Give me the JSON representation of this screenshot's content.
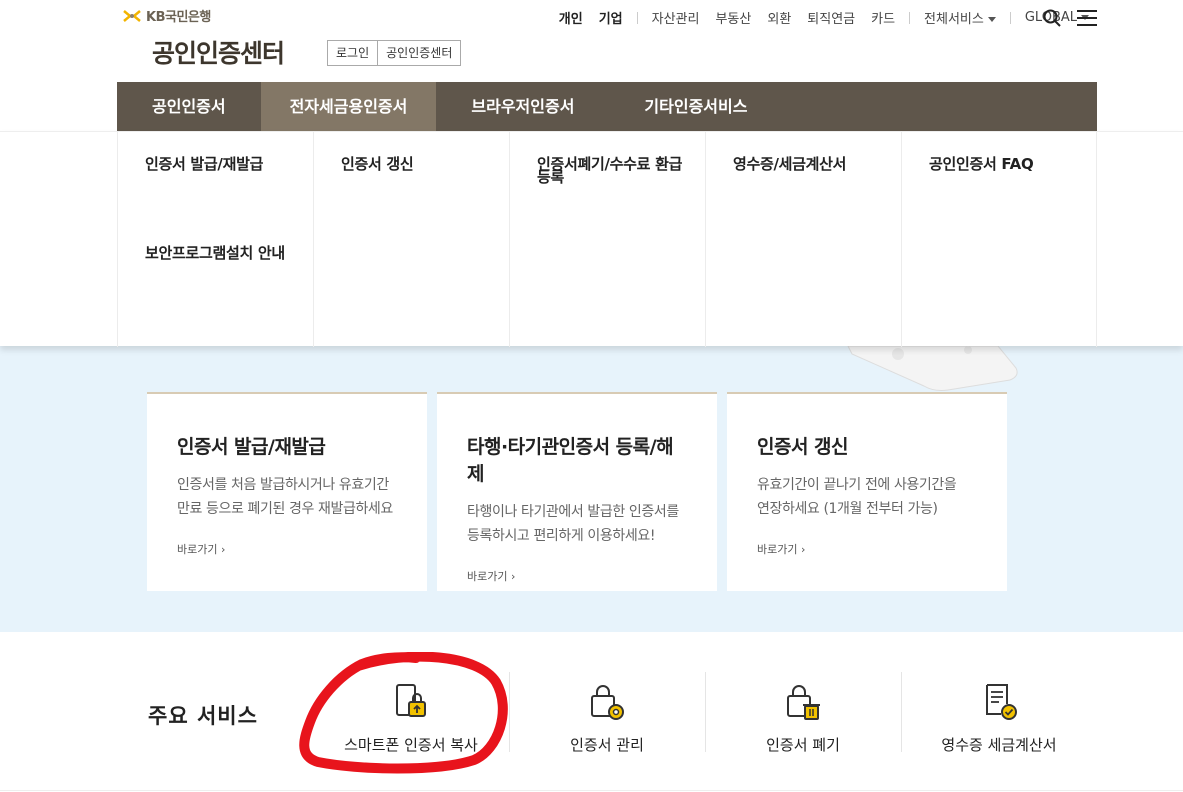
{
  "header": {
    "logo_text": "KB국민은행",
    "site_title": "공인인증센터",
    "breadcrumb": [
      "로그인",
      "공인인증센터"
    ]
  },
  "util_nav": [
    "개인",
    "기업",
    "자산관리",
    "부동산",
    "외환",
    "퇴직연금",
    "카드",
    "전체서비스",
    "GLOBAL"
  ],
  "main_nav": {
    "tabs": [
      "공인인증서",
      "전자세금용인증서",
      "브라우저인증서",
      "기타인증서비스"
    ],
    "active": "전자세금용인증서"
  },
  "mega_menu": {
    "col1": [
      "인증서 발급/재발급",
      "보안프로그램설치 안내"
    ],
    "col2": "인증서 갱신",
    "col3": "인증서폐기/수수료 환급등록",
    "col4": "영수증/세금계산서",
    "col5": "공인인증서 FAQ"
  },
  "cards": [
    {
      "title": "인증서 발급/재발급",
      "desc1": "인증서를 처음 발급하시거나 유효기간",
      "desc2": "만료 등으로 폐기된 경우 재발급하세요",
      "link": "바로가기"
    },
    {
      "title": "타행·타기관인증서 등록/해제",
      "desc1": "타행이나 타기관에서 발급한 인증서를",
      "desc2": "등록하시고 편리하게 이용하세요!",
      "link": "바로가기"
    },
    {
      "title": "인증서 갱신",
      "desc1": "유효기간이 끝나기 전에 사용기간을",
      "desc2": "연장하세요 (1개월 전부터 가능)",
      "link": "바로가기"
    }
  ],
  "services": {
    "title": "주요 서비스",
    "items": [
      {
        "label": "스마트폰 인증서 복사",
        "icon": "smartphone-copy-icon"
      },
      {
        "label": "인증서 관리",
        "icon": "certificate-settings-icon"
      },
      {
        "label": "인증서 폐기",
        "icon": "certificate-delete-icon"
      },
      {
        "label": "영수증 세금계산서",
        "icon": "receipt-check-icon"
      }
    ]
  },
  "colors": {
    "nav_bg": "#5f564b",
    "nav_active": "#837766",
    "hero_bg": "#e7f3fb",
    "accent_yellow": "#f2c200",
    "annotation_red": "#e8141c"
  }
}
